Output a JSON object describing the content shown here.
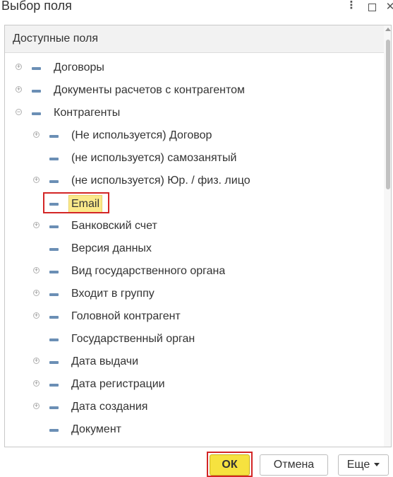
{
  "window": {
    "title": "Выбор поля"
  },
  "panel": {
    "header": "Доступные поля"
  },
  "tree": [
    {
      "label": "Договоры",
      "level": 0,
      "expandable": true,
      "expanded": false
    },
    {
      "label": "Документы расчетов с контрагентом",
      "level": 0,
      "expandable": true,
      "expanded": false
    },
    {
      "label": "Контрагенты",
      "level": 0,
      "expandable": true,
      "expanded": true
    },
    {
      "label": "(Не используется) Договор",
      "level": 1,
      "expandable": true,
      "expanded": false
    },
    {
      "label": "(не используется) самозанятый",
      "level": 1,
      "expandable": false
    },
    {
      "label": "(не используется) Юр. / физ. лицо",
      "level": 1,
      "expandable": true,
      "expanded": false
    },
    {
      "label": "Email",
      "level": 1,
      "expandable": false,
      "selected": true
    },
    {
      "label": "Банковский счет",
      "level": 1,
      "expandable": true,
      "expanded": false
    },
    {
      "label": "Версия данных",
      "level": 1,
      "expandable": false
    },
    {
      "label": "Вид государственного органа",
      "level": 1,
      "expandable": true,
      "expanded": false
    },
    {
      "label": "Входит в группу",
      "level": 1,
      "expandable": true,
      "expanded": false
    },
    {
      "label": "Головной контрагент",
      "level": 1,
      "expandable": true,
      "expanded": false
    },
    {
      "label": "Государственный орган",
      "level": 1,
      "expandable": false
    },
    {
      "label": "Дата выдачи",
      "level": 1,
      "expandable": true,
      "expanded": false
    },
    {
      "label": "Дата регистрации",
      "level": 1,
      "expandable": true,
      "expanded": false
    },
    {
      "label": "Дата создания",
      "level": 1,
      "expandable": true,
      "expanded": false
    },
    {
      "label": "Документ",
      "level": 1,
      "expandable": false
    }
  ],
  "buttons": {
    "ok": "ОК",
    "cancel": "Отмена",
    "more": "Еще"
  },
  "icons": {
    "more": "kebab-icon",
    "maximize": "maximize-icon",
    "close": "close-icon",
    "expand": "expand-plus-icon",
    "collapse": "collapse-minus-icon",
    "field": "field-dash-icon"
  },
  "colors": {
    "accent_ok": "#f6e23f",
    "selection": "#fbe98a",
    "highlight_frame": "#d32626",
    "field_marker": "#6b8fb5"
  }
}
